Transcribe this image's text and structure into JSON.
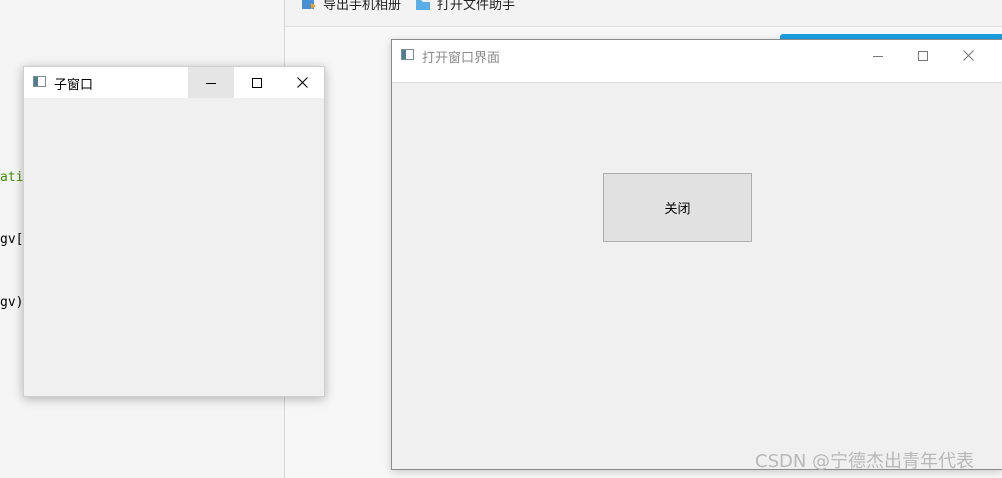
{
  "editor": {
    "code_fragments": [
      "atio",
      "gv[]",
      "gv)"
    ],
    "code_colors": [
      "#3f8f00",
      "#000000",
      "#000000"
    ]
  },
  "background_app": {
    "toolbar": [
      {
        "label": "导出手机相册",
        "icon": "export-photo-icon"
      },
      {
        "label": "打开文件助手",
        "icon": "folder-icon"
      }
    ],
    "accent_color": "#1a9fe0"
  },
  "child_window": {
    "title": "子窗口",
    "icon": "window-app-icon",
    "controls": {
      "minimize": "minimize-icon",
      "maximize": "maximize-icon",
      "close": "close-icon"
    }
  },
  "main_window": {
    "title": "打开窗口界面",
    "icon": "window-app-icon",
    "controls": {
      "minimize": "minimize-icon",
      "maximize": "maximize-icon",
      "close": "close-icon"
    },
    "close_button_label": "关闭"
  },
  "watermark": "CSDN @宁德杰出青年代表"
}
